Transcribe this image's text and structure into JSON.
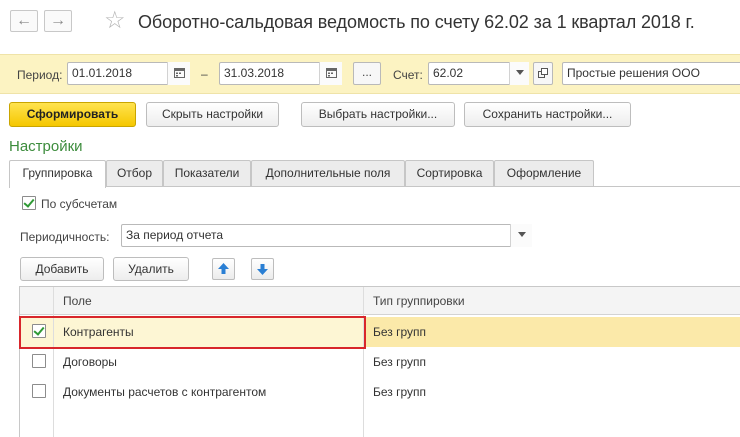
{
  "window": {
    "title": "Оборотно-сальдовая ведомость по счету 62.02 за 1 квартал 2018 г.",
    "back_glyph": "←",
    "forward_glyph": "→",
    "star_glyph": "☆"
  },
  "params": {
    "period_label": "Период:",
    "date_from": "01.01.2018",
    "dash": "–",
    "date_to": "31.03.2018",
    "more_glyph": "...",
    "account_label": "Счет:",
    "account_value": "62.02",
    "organization_value": "Простые решения ООО"
  },
  "toolbar": {
    "generate_label": "Сформировать",
    "hide_settings_label": "Скрыть настройки",
    "choose_settings_label": "Выбрать настройки...",
    "save_settings_label": "Сохранить настройки..."
  },
  "settings": {
    "title": "Настройки",
    "tabs": [
      {
        "label": "Группировка",
        "active": true
      },
      {
        "label": "Отбор"
      },
      {
        "label": "Показатели"
      },
      {
        "label": "Дополнительные поля"
      },
      {
        "label": "Сортировка"
      },
      {
        "label": "Оформление"
      }
    ],
    "by_subaccounts_label": "По субсчетам",
    "by_subaccounts_checked": true,
    "periodicity_label": "Периодичность:",
    "periodicity_value": "За период отчета",
    "add_label": "Добавить",
    "delete_label": "Удалить"
  },
  "grouping_table": {
    "columns": [
      "Поле",
      "Тип группировки"
    ],
    "rows": [
      {
        "field": "Контрагенты",
        "type": "Без групп",
        "checked": true,
        "selected": true
      },
      {
        "field": "Договоры",
        "type": "Без групп",
        "checked": false
      },
      {
        "field": "Документы расчетов с контрагентом",
        "type": "Без групп",
        "checked": false
      }
    ]
  },
  "colors": {
    "accent_yellow": "#f5c700",
    "band": "#fcf3c2",
    "selected_row": "#fbe9a9",
    "highlight": "#d8262b",
    "section_green": "#3c8c3c",
    "arrow_blue": "#2a7fd4"
  }
}
